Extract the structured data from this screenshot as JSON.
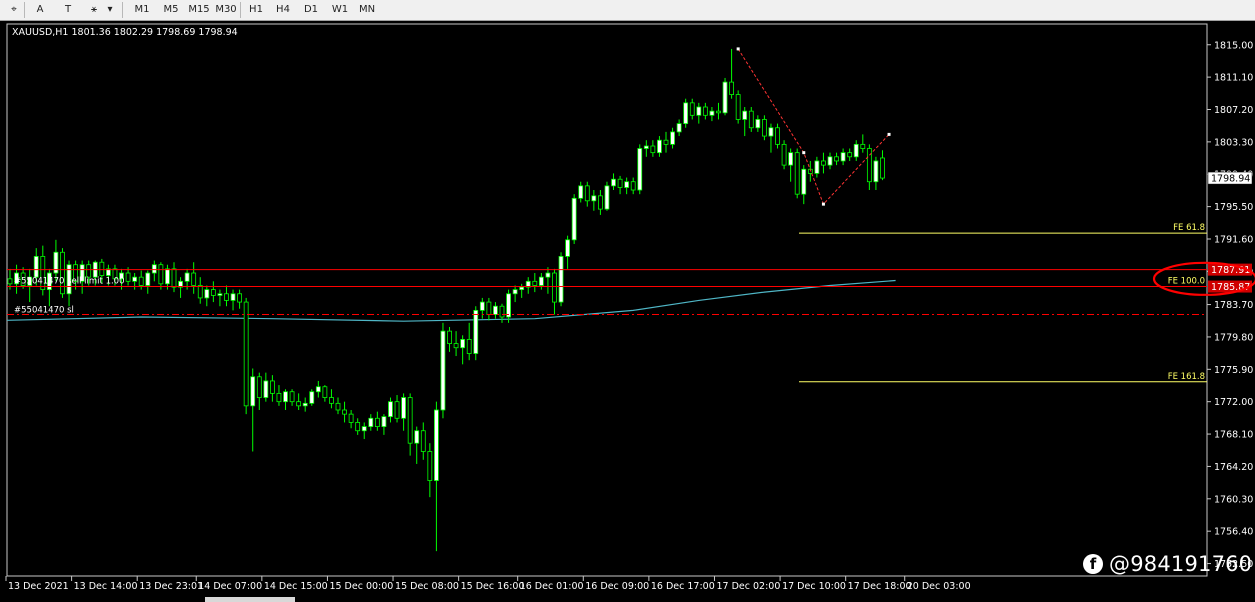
{
  "toolbar": {
    "tools": [
      {
        "name": "cursor-tool",
        "glyph": "⌖"
      },
      {
        "name": "text-tool",
        "glyph": "A"
      },
      {
        "name": "label-tool",
        "glyph": "T"
      },
      {
        "name": "shapes-tool",
        "glyph": "⚹"
      }
    ],
    "timeframes": [
      "M1",
      "M5",
      "M15",
      "M30",
      "H1",
      "H4",
      "D1",
      "W1",
      "MN"
    ]
  },
  "colors": {
    "background": "#000000",
    "bull_candle": "#ffffff",
    "bear_candle": "#000000",
    "candle_outline": "#00ff00",
    "ma_line": "#4fb6c6",
    "order_line": "#ff0000",
    "fe_line": "#ffff66",
    "zigzag": "#ff3333",
    "price_text": "#ffffff",
    "annotation_circle": "#ff0000"
  },
  "chart_data": {
    "type": "candlestick",
    "symbol_header": "XAUUSD,H1  1801.36 1802.29 1798.69 1798.94",
    "ylim": [
      1751.0,
      1817.5
    ],
    "y_ticks": [
      "1815.00",
      "1811.10",
      "1807.20",
      "1803.30",
      "1799.40",
      "1795.50",
      "1791.60",
      "1787.70",
      "1783.70",
      "1779.80",
      "1775.90",
      "1772.00",
      "1768.10",
      "1764.20",
      "1760.30",
      "1756.40",
      "1752.50"
    ],
    "x_ticks": [
      "13 Dec 2021",
      "13 Dec 14:00",
      "13 Dec 23:01",
      "14 Dec 07:00",
      "14 Dec 15:00",
      "15 Dec 00:00",
      "15 Dec 08:00",
      "15 Dec 16:00",
      "16 Dec 01:00",
      "16 Dec 09:00",
      "16 Dec 17:00",
      "17 Dec 02:00",
      "17 Dec 10:00",
      "17 Dec 18:00",
      "20 Dec 03:00"
    ],
    "current_price": "1798.94",
    "ohlc": [
      [
        1786.8,
        1788.0,
        1785.5,
        1786.2
      ],
      [
        1786.2,
        1788.5,
        1785.0,
        1787.5
      ],
      [
        1787.5,
        1788.2,
        1785.6,
        1786.0
      ],
      [
        1786.0,
        1788.0,
        1784.0,
        1787.0
      ],
      [
        1787.0,
        1790.5,
        1786.0,
        1789.5
      ],
      [
        1789.5,
        1790.8,
        1784.8,
        1785.5
      ],
      [
        1785.5,
        1788.0,
        1783.5,
        1787.5
      ],
      [
        1787.5,
        1791.5,
        1786.5,
        1790.0
      ],
      [
        1790.0,
        1790.5,
        1784.5,
        1785.0
      ],
      [
        1785.0,
        1789.0,
        1783.5,
        1788.5
      ],
      [
        1788.5,
        1789.0,
        1785.5,
        1786.5
      ],
      [
        1786.5,
        1789.0,
        1785.0,
        1788.5
      ],
      [
        1788.5,
        1789.0,
        1786.0,
        1787.0
      ],
      [
        1787.0,
        1789.0,
        1786.0,
        1788.8
      ],
      [
        1788.8,
        1789.2,
        1786.2,
        1787.2
      ],
      [
        1787.2,
        1788.5,
        1786.0,
        1788.0
      ],
      [
        1788.0,
        1788.5,
        1786.0,
        1786.8
      ],
      [
        1786.8,
        1788.0,
        1785.5,
        1787.5
      ],
      [
        1787.5,
        1788.2,
        1786.0,
        1786.5
      ],
      [
        1786.5,
        1787.5,
        1785.5,
        1787.0
      ],
      [
        1787.0,
        1787.8,
        1785.5,
        1786.0
      ],
      [
        1786.0,
        1787.8,
        1785.0,
        1787.5
      ],
      [
        1787.5,
        1789.0,
        1786.5,
        1788.5
      ],
      [
        1788.5,
        1788.8,
        1785.5,
        1786.2
      ],
      [
        1786.2,
        1788.5,
        1785.5,
        1788.0
      ],
      [
        1788.0,
        1788.8,
        1785.2,
        1785.8
      ],
      [
        1785.8,
        1787.0,
        1784.5,
        1786.5
      ],
      [
        1786.5,
        1788.0,
        1785.5,
        1787.5
      ],
      [
        1787.5,
        1788.8,
        1785.0,
        1786.0
      ],
      [
        1786.0,
        1787.0,
        1783.8,
        1784.5
      ],
      [
        1784.5,
        1786.0,
        1783.5,
        1785.5
      ],
      [
        1785.5,
        1786.5,
        1784.0,
        1784.8
      ],
      [
        1784.8,
        1785.5,
        1783.5,
        1785.0
      ],
      [
        1785.0,
        1786.0,
        1783.5,
        1784.2
      ],
      [
        1784.2,
        1785.5,
        1783.0,
        1785.0
      ],
      [
        1785.0,
        1785.5,
        1783.2,
        1784.0
      ],
      [
        1784.0,
        1784.5,
        1770.5,
        1771.5
      ],
      [
        1771.5,
        1776.0,
        1766.0,
        1775.0
      ],
      [
        1775.0,
        1775.5,
        1771.0,
        1772.5
      ],
      [
        1772.5,
        1775.5,
        1772.0,
        1774.5
      ],
      [
        1774.5,
        1775.2,
        1772.0,
        1773.0
      ],
      [
        1773.0,
        1774.0,
        1771.5,
        1772.0
      ],
      [
        1772.0,
        1773.5,
        1771.0,
        1773.2
      ],
      [
        1773.2,
        1773.5,
        1771.5,
        1772.0
      ],
      [
        1772.0,
        1773.0,
        1771.0,
        1771.5
      ],
      [
        1771.5,
        1772.5,
        1770.8,
        1771.8
      ],
      [
        1771.8,
        1773.5,
        1771.5,
        1773.2
      ],
      [
        1773.2,
        1774.5,
        1772.5,
        1773.8
      ],
      [
        1773.8,
        1774.0,
        1772.0,
        1772.5
      ],
      [
        1772.5,
        1773.5,
        1771.2,
        1771.8
      ],
      [
        1771.8,
        1772.5,
        1770.5,
        1771.0
      ],
      [
        1771.0,
        1772.0,
        1769.5,
        1770.5
      ],
      [
        1770.5,
        1771.0,
        1768.8,
        1769.5
      ],
      [
        1769.5,
        1770.0,
        1768.0,
        1768.5
      ],
      [
        1768.5,
        1769.5,
        1767.5,
        1769.0
      ],
      [
        1769.0,
        1770.5,
        1768.5,
        1770.0
      ],
      [
        1770.0,
        1770.8,
        1768.5,
        1769.0
      ],
      [
        1769.0,
        1770.5,
        1768.0,
        1770.2
      ],
      [
        1770.2,
        1772.5,
        1769.5,
        1772.0
      ],
      [
        1772.0,
        1772.8,
        1769.5,
        1770.0
      ],
      [
        1770.0,
        1773.0,
        1768.5,
        1772.5
      ],
      [
        1772.5,
        1773.0,
        1765.5,
        1767.0
      ],
      [
        1767.0,
        1769.0,
        1764.5,
        1768.5
      ],
      [
        1768.5,
        1769.5,
        1765.0,
        1766.0
      ],
      [
        1766.0,
        1767.0,
        1760.5,
        1762.5
      ],
      [
        1762.5,
        1772.0,
        1754.0,
        1771.0
      ],
      [
        1771.0,
        1781.5,
        1770.0,
        1780.5
      ],
      [
        1780.5,
        1781.0,
        1778.0,
        1779.0
      ],
      [
        1779.0,
        1780.5,
        1777.5,
        1778.5
      ],
      [
        1778.5,
        1780.0,
        1776.5,
        1779.5
      ],
      [
        1779.5,
        1781.5,
        1777.0,
        1777.8
      ],
      [
        1777.8,
        1783.5,
        1777.0,
        1783.0
      ],
      [
        1783.0,
        1784.5,
        1782.0,
        1784.0
      ],
      [
        1784.0,
        1784.5,
        1781.8,
        1782.5
      ],
      [
        1782.5,
        1784.0,
        1782.0,
        1783.5
      ],
      [
        1783.5,
        1783.8,
        1781.5,
        1782.2
      ],
      [
        1782.2,
        1785.5,
        1781.5,
        1785.0
      ],
      [
        1785.0,
        1786.0,
        1784.0,
        1785.5
      ],
      [
        1785.5,
        1786.2,
        1784.5,
        1785.8
      ],
      [
        1785.8,
        1787.0,
        1785.0,
        1786.5
      ],
      [
        1786.5,
        1787.5,
        1785.2,
        1786.0
      ],
      [
        1786.0,
        1787.5,
        1785.5,
        1787.0
      ],
      [
        1787.0,
        1788.2,
        1785.0,
        1787.5
      ],
      [
        1787.5,
        1788.0,
        1782.5,
        1784.0
      ],
      [
        1784.0,
        1790.0,
        1783.5,
        1789.5
      ],
      [
        1789.5,
        1792.0,
        1788.0,
        1791.5
      ],
      [
        1791.5,
        1797.0,
        1791.0,
        1796.5
      ],
      [
        1796.5,
        1798.5,
        1796.0,
        1798.0
      ],
      [
        1798.0,
        1798.5,
        1795.5,
        1796.2
      ],
      [
        1796.2,
        1797.5,
        1795.0,
        1796.8
      ],
      [
        1796.8,
        1797.5,
        1794.5,
        1795.2
      ],
      [
        1795.2,
        1798.5,
        1795.0,
        1798.0
      ],
      [
        1798.0,
        1799.5,
        1797.5,
        1798.8
      ],
      [
        1798.8,
        1799.2,
        1797.0,
        1797.8
      ],
      [
        1797.8,
        1799.0,
        1797.0,
        1798.5
      ],
      [
        1798.5,
        1799.0,
        1797.0,
        1797.5
      ],
      [
        1797.5,
        1803.0,
        1797.0,
        1802.5
      ],
      [
        1802.5,
        1803.5,
        1801.5,
        1802.8
      ],
      [
        1802.8,
        1803.5,
        1801.5,
        1802.0
      ],
      [
        1802.0,
        1804.0,
        1801.5,
        1803.5
      ],
      [
        1803.5,
        1804.5,
        1802.0,
        1803.0
      ],
      [
        1803.0,
        1805.0,
        1802.5,
        1804.5
      ],
      [
        1804.5,
        1806.0,
        1804.0,
        1805.5
      ],
      [
        1805.5,
        1808.5,
        1805.0,
        1808.0
      ],
      [
        1808.0,
        1808.5,
        1806.0,
        1806.5
      ],
      [
        1806.5,
        1808.0,
        1805.5,
        1807.5
      ],
      [
        1807.5,
        1808.0,
        1806.0,
        1806.5
      ],
      [
        1806.5,
        1807.5,
        1805.8,
        1807.0
      ],
      [
        1807.0,
        1808.0,
        1806.0,
        1806.8
      ],
      [
        1806.8,
        1811.0,
        1806.5,
        1810.5
      ],
      [
        1810.5,
        1814.5,
        1808.5,
        1809.0
      ],
      [
        1809.0,
        1809.5,
        1805.5,
        1806.0
      ],
      [
        1806.0,
        1807.5,
        1804.0,
        1807.0
      ],
      [
        1807.0,
        1807.5,
        1804.5,
        1805.0
      ],
      [
        1805.0,
        1806.5,
        1804.5,
        1806.0
      ],
      [
        1806.0,
        1806.5,
        1803.5,
        1804.0
      ],
      [
        1804.0,
        1805.5,
        1802.0,
        1805.0
      ],
      [
        1805.0,
        1805.5,
        1802.5,
        1803.0
      ],
      [
        1803.0,
        1803.5,
        1800.0,
        1800.5
      ],
      [
        1800.5,
        1802.5,
        1798.5,
        1802.0
      ],
      [
        1802.0,
        1802.5,
        1796.5,
        1797.0
      ],
      [
        1797.0,
        1800.5,
        1795.8,
        1800.0
      ],
      [
        1800.0,
        1801.0,
        1798.5,
        1799.5
      ],
      [
        1799.5,
        1801.5,
        1799.0,
        1801.0
      ],
      [
        1801.0,
        1802.0,
        1799.5,
        1800.5
      ],
      [
        1800.5,
        1802.0,
        1800.0,
        1801.5
      ],
      [
        1801.5,
        1802.0,
        1800.5,
        1801.0
      ],
      [
        1801.0,
        1802.5,
        1800.5,
        1802.0
      ],
      [
        1802.0,
        1802.5,
        1801.0,
        1801.5
      ],
      [
        1801.5,
        1803.5,
        1801.0,
        1803.0
      ],
      [
        1803.0,
        1804.2,
        1802.0,
        1802.5
      ],
      [
        1802.5,
        1803.0,
        1797.5,
        1798.5
      ],
      [
        1798.5,
        1801.5,
        1797.5,
        1801.0
      ],
      [
        1801.36,
        1802.29,
        1798.69,
        1798.94
      ]
    ],
    "ma": [
      [
        0,
        1781.8
      ],
      [
        20,
        1782.2
      ],
      [
        40,
        1782.0
      ],
      [
        60,
        1781.7
      ],
      [
        80,
        1782.0
      ],
      [
        95,
        1783.0
      ],
      [
        105,
        1784.2
      ],
      [
        115,
        1785.2
      ],
      [
        125,
        1786.0
      ],
      [
        135,
        1786.6
      ]
    ],
    "zigzag_points": [
      [
        111,
        1814.5
      ],
      [
        121,
        1802.0
      ],
      [
        124,
        1795.8
      ],
      [
        134,
        1804.2
      ]
    ],
    "order_lines": [
      {
        "label": "#55041470 sell limit 1.00",
        "price": 1785.87,
        "style": "solid",
        "axis_label": "1785.87"
      },
      {
        "label": "",
        "price": 1787.91,
        "style": "solid",
        "axis_label": "1787.91"
      },
      {
        "label": "#55041470 sl",
        "price": 1782.5,
        "style": "dashdot",
        "axis_label": ""
      }
    ],
    "fe_levels": [
      {
        "label": "FE 61.8",
        "price": 1792.3
      },
      {
        "label": "FE 100.0",
        "price": 1785.87
      },
      {
        "label": "FE 161.8",
        "price": 1774.4
      }
    ]
  },
  "watermark": {
    "icon": "f",
    "text": "@984191760"
  }
}
